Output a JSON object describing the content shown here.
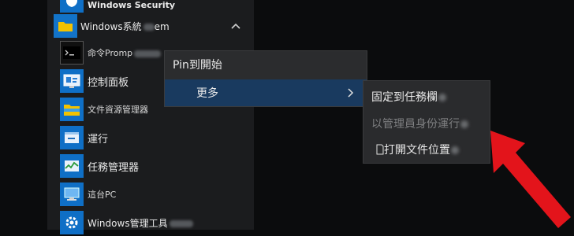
{
  "start_menu": {
    "rows": [
      {
        "label": "Windows Security"
      },
      {
        "label": "Windows系統",
        "label_tail": "em"
      },
      {
        "label": "命令Promp"
      },
      {
        "label": "控制面板"
      },
      {
        "label": "文件資源管理器"
      },
      {
        "label": "運行"
      },
      {
        "label": "任務管理器"
      },
      {
        "label": "這台PC"
      },
      {
        "label": "Windows管理工具"
      }
    ]
  },
  "context_menu": {
    "pin_label": "Pin到開始",
    "more_label": "更多"
  },
  "submenu": {
    "pin_taskbar": "固定到任務欄",
    "run_as_admin": "以管理員身份運行",
    "open_location": "打開文件位置"
  },
  "colors": {
    "highlight": "#193a5f",
    "tile_blue": "#0f6fc6",
    "annotation_arrow": "#e3141b"
  }
}
